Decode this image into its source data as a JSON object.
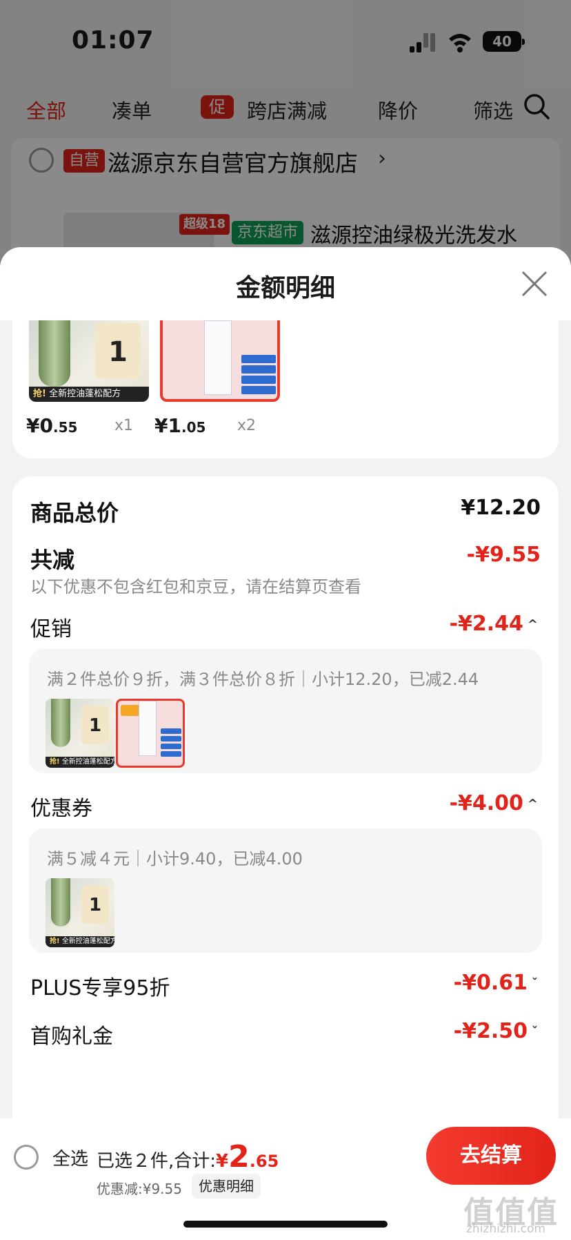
{
  "status": {
    "time": "01:07",
    "battery": "40"
  },
  "background": {
    "tabs": [
      "全部",
      "凑单",
      "跨店满减",
      "降价",
      "筛选"
    ],
    "promo_badge": "促",
    "store_badge": "自营",
    "store_name": "滋源京东自营官方旗舰店",
    "store_chevron": "›",
    "level_badge": "超级18",
    "market_badge": "京东超市",
    "product_title": "滋源控油绿极光洗发水"
  },
  "sheet": {
    "title": "金额明细",
    "products": [
      {
        "price_int": "¥0",
        "price_dec": ".55",
        "qty": "x1",
        "thumb_tag": "抢!",
        "thumb_caption": "全新控油蓬松配方",
        "coupon_text": "1"
      },
      {
        "price_int": "¥1",
        "price_dec": ".05",
        "qty": "x2"
      }
    ],
    "total_label": "商品总价",
    "total_value": "¥12.20",
    "reduce_label": "共减",
    "reduce_value": "-¥9.55",
    "reduce_note": "以下优惠不包含红包和京豆，请在结算页查看",
    "promo": {
      "label": "促销",
      "value": "-¥2.44",
      "detail": "满２件总价９折，满３件总价８折｜小计12.20，已减2.44"
    },
    "coupon": {
      "label": "优惠券",
      "value": "-¥4.00",
      "detail": "满５减４元｜小计9.40，已减4.00"
    },
    "plus": {
      "label": "PLUS专享95折",
      "value": "-¥0.61"
    },
    "first": {
      "label": "首购礼金",
      "value": "-¥2.50"
    }
  },
  "footer": {
    "select_all": "全选",
    "selected_text": "已选２件,合计:",
    "total_symbol": "¥",
    "total_int": "2",
    "total_dec": ".65",
    "discount_text": "优惠减:¥9.55",
    "detail_link": "优惠明细",
    "checkout": "去结算"
  },
  "watermark": {
    "main": "值值值",
    "sub": "zhizhizhi.com"
  },
  "colors": {
    "accent": "#e2231a",
    "market_green": "#0e9f54"
  }
}
